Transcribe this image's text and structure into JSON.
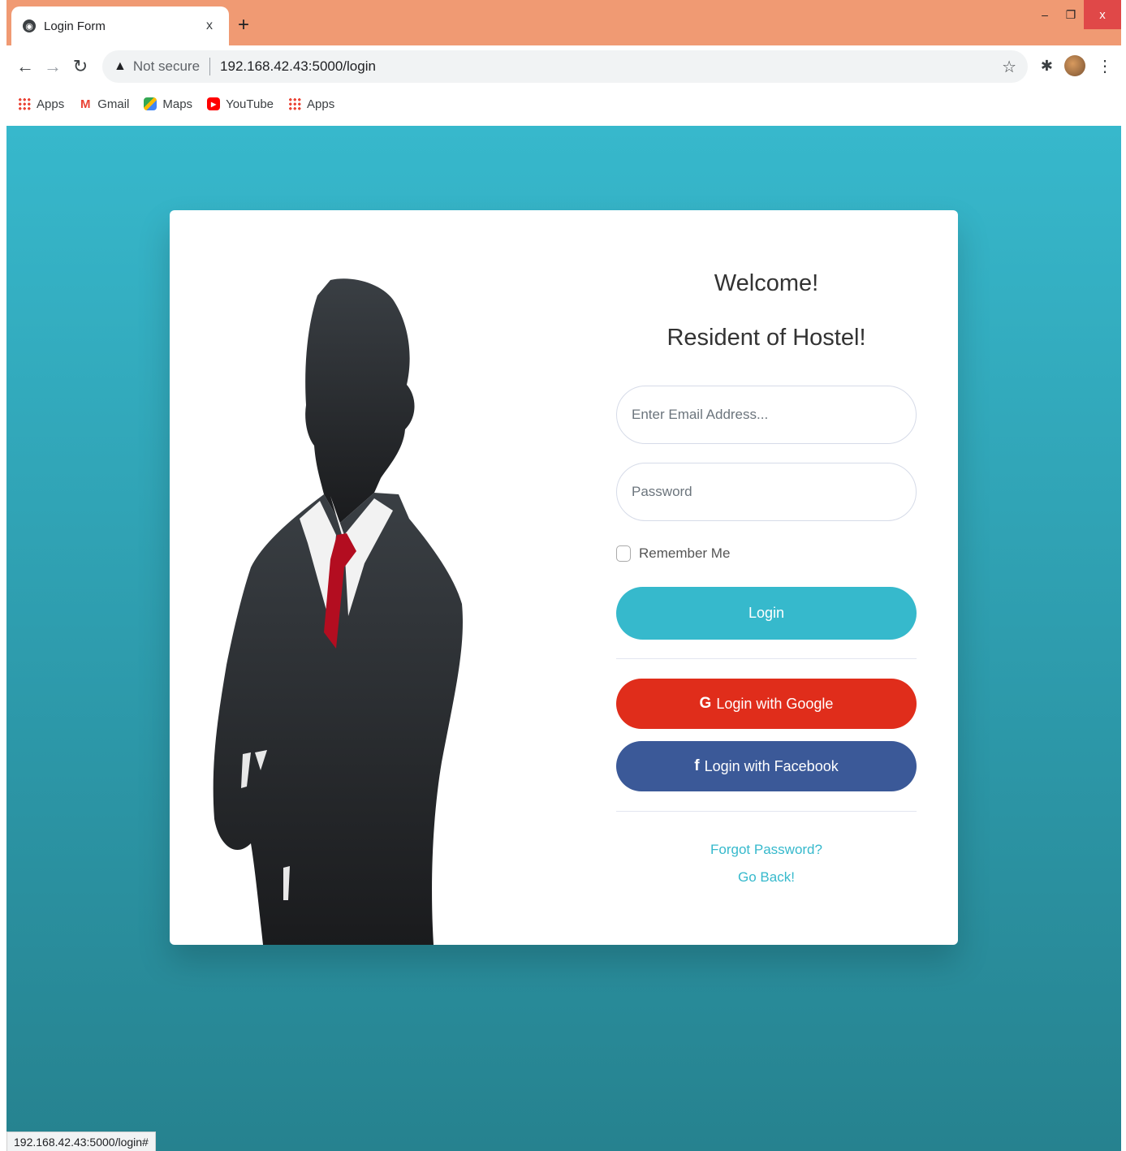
{
  "browser": {
    "tab_title": "Login Form",
    "tab_close": "x",
    "new_tab": "+",
    "window": {
      "minimize": "–",
      "restore": "❐",
      "close": "x"
    },
    "security_label": "Not secure",
    "url": "192.168.42.43:5000/login",
    "bookmarks": [
      {
        "label": "Apps",
        "icon": "apps-grid-icon"
      },
      {
        "label": "Gmail",
        "icon": "gmail-icon"
      },
      {
        "label": "Maps",
        "icon": "maps-icon"
      },
      {
        "label": "YouTube",
        "icon": "youtube-icon"
      },
      {
        "label": "Apps",
        "icon": "apps-grid-icon"
      }
    ],
    "status_url": "192.168.42.43:5000/login#"
  },
  "colors": {
    "page_top": "#37b8cc",
    "page_bottom": "#26828f",
    "login_button": "#36b9cc",
    "google_button": "#e02d1b",
    "facebook_button": "#3b5998",
    "tab_strip": "#f09a73"
  },
  "login": {
    "heading": "Welcome!",
    "subheading": "Resident of Hostel!",
    "email_placeholder": "Enter Email Address...",
    "password_placeholder": "Password",
    "remember_label": "Remember Me",
    "login_button": "Login",
    "google_button": "Login with Google",
    "facebook_button": "Login with Facebook",
    "forgot_password": "Forgot Password?",
    "go_back": "Go Back!"
  }
}
